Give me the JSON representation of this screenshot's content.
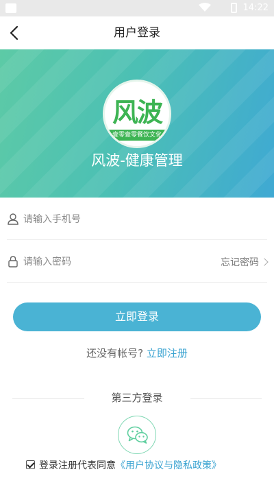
{
  "status_bar": {
    "time": "14:22"
  },
  "nav": {
    "title": "用户登录",
    "back_icon": "chevron-left-icon"
  },
  "hero": {
    "logo_text": "风波",
    "logo_band_text": "壹零壹零餐饮文化",
    "app_name": "风波-健康管理"
  },
  "form": {
    "phone_placeholder": "请输入手机号",
    "phone_value": "",
    "password_placeholder": "请输入密码",
    "password_value": "",
    "forgot_label": "忘记密码",
    "login_label": "立即登录"
  },
  "register": {
    "prompt": "还没有帐号?",
    "link": "立即注册"
  },
  "third_party": {
    "title": "第三方登录",
    "wechat_icon": "wechat-icon"
  },
  "agreement": {
    "checked": true,
    "text": "登录注册代表同意",
    "link": "《用户协议与隐私政策》"
  },
  "colors": {
    "primary": "#4ab3d4",
    "link": "#3aa3d1",
    "brand_green": "#3db453",
    "gradient_start": "#5dcaa6",
    "gradient_end": "#3fa9d3"
  }
}
